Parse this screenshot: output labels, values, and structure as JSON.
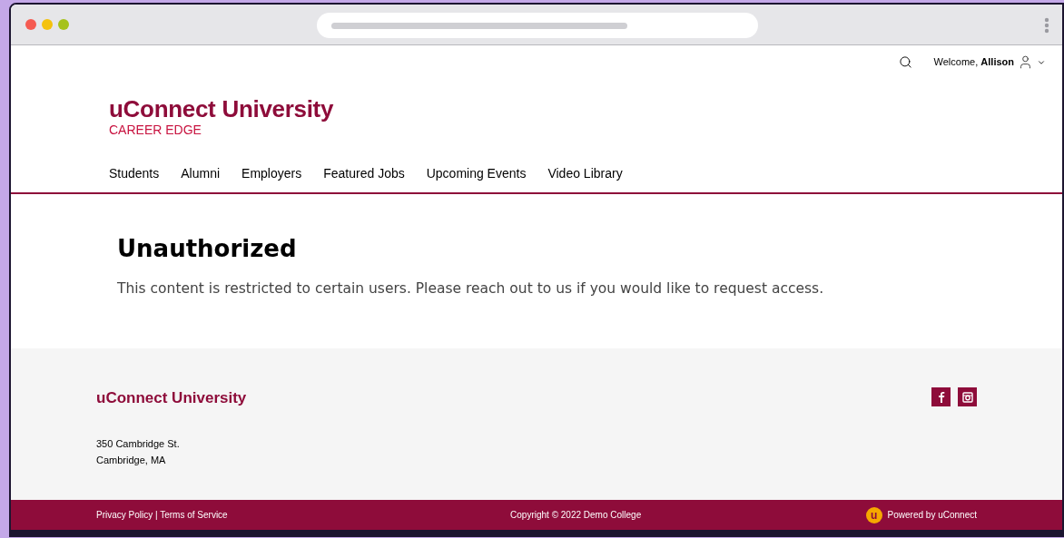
{
  "header": {
    "welcome": "Welcome, **Allison**",
    "logo_title": "uConnect University",
    "logo_subtitle": "CAREER EDGE"
  },
  "nav": [
    {
      "label": "Students"
    },
    {
      "label": "Alumni"
    },
    {
      "label": "Employers"
    },
    {
      "label": "Featured Jobs"
    },
    {
      "label": "Upcoming Events"
    },
    {
      "label": "Video Library"
    }
  ],
  "content": {
    "title": "Unauthorized",
    "message": "This content is restricted to certain users. Please reach out to us if you would like to request access."
  },
  "footer": {
    "name": "uConnect University",
    "address": [
      "350 Cambridge St.",
      "Cambridge, MA"
    ],
    "links": "Privacy Policy | Terms of Service",
    "copyright": "Copyright © 2022 Demo College",
    "logo_letter": "u",
    "powered": "Powered by uConnect"
  }
}
